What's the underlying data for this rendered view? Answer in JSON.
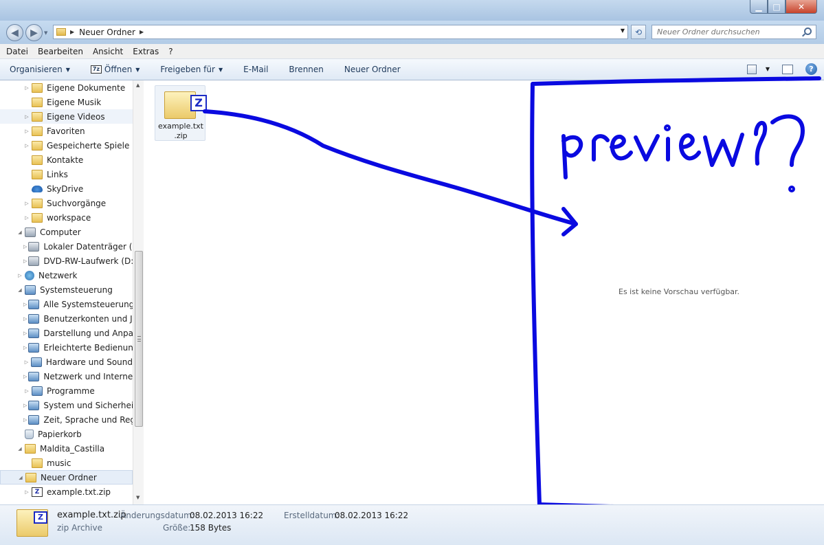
{
  "window": {
    "minimize": "▁",
    "maximize": "□",
    "close": "✕"
  },
  "address": {
    "path": "Neuer Ordner",
    "search_placeholder": "Neuer Ordner durchsuchen"
  },
  "menu": [
    "Datei",
    "Bearbeiten",
    "Ansicht",
    "Extras",
    "?"
  ],
  "toolbar": {
    "organize": "Organisieren",
    "open": "Öffnen",
    "open_badge": "7z",
    "share": "Freigeben für",
    "email": "E-Mail",
    "burn": "Brennen",
    "new_folder": "Neuer Ordner",
    "help": "?"
  },
  "tree": [
    {
      "label": "Eigene Dokumente",
      "icon": "folder"
    },
    {
      "label": "Eigene Musik",
      "icon": "folder"
    },
    {
      "label": "Eigene Videos",
      "icon": "folder"
    },
    {
      "label": "Favoriten",
      "icon": "folder"
    },
    {
      "label": "Gespeicherte Spiele",
      "icon": "folder"
    },
    {
      "label": "Kontakte",
      "icon": "folder"
    },
    {
      "label": "Links",
      "icon": "folder"
    },
    {
      "label": "SkyDrive",
      "icon": "cloud"
    },
    {
      "label": "Suchvorgänge",
      "icon": "folder"
    },
    {
      "label": "workspace",
      "icon": "folder"
    },
    {
      "label": "Computer",
      "icon": "computer"
    },
    {
      "label": "Lokaler Datenträger (C:)",
      "icon": "drive"
    },
    {
      "label": "DVD-RW-Laufwerk (D:)",
      "icon": "drive"
    },
    {
      "label": "Netzwerk",
      "icon": "network"
    },
    {
      "label": "Systemsteuerung",
      "icon": "control-panel"
    },
    {
      "label": "Alle Systemsteuerungse",
      "icon": "control-panel"
    },
    {
      "label": "Benutzerkonten und Jug",
      "icon": "control-panel"
    },
    {
      "label": "Darstellung und Anpass",
      "icon": "control-panel"
    },
    {
      "label": "Erleichterte Bedienung",
      "icon": "control-panel"
    },
    {
      "label": "Hardware und Sound",
      "icon": "control-panel"
    },
    {
      "label": "Netzwerk und Internet",
      "icon": "control-panel"
    },
    {
      "label": "Programme",
      "icon": "control-panel"
    },
    {
      "label": "System und Sicherheit",
      "icon": "control-panel"
    },
    {
      "label": "Zeit, Sprache und Regio",
      "icon": "control-panel"
    },
    {
      "label": "Papierkorb",
      "icon": "recycle-bin"
    },
    {
      "label": "Maldita_Castilla",
      "icon": "folder"
    },
    {
      "label": "music",
      "icon": "folder"
    },
    {
      "label": "Neuer Ordner",
      "icon": "folder"
    },
    {
      "label": "example.txt.zip",
      "icon": "zip"
    }
  ],
  "file": {
    "name": "example.txt\n.zip",
    "badge": "Z"
  },
  "annotation": {
    "text": "preview?",
    "color": "#0a0ae0"
  },
  "preview": {
    "message": "Es ist keine Vorschau verfügbar."
  },
  "details": {
    "name": "example.txt.zip",
    "type": "zip Archive",
    "modified_label": "Änderungsdatum:",
    "modified_value": "08.02.2013 16:22",
    "created_label": "Erstelldatum:",
    "created_value": "08.02.2013 16:22",
    "size_label": "Größe:",
    "size_value": "158 Bytes"
  }
}
